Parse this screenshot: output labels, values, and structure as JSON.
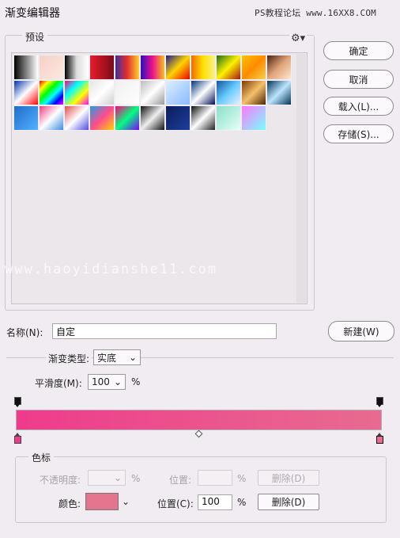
{
  "window": {
    "title": "渐变编辑器",
    "watermark_top": "PS教程论坛 www.16XX8.COM",
    "watermark_mid": "www.haoyidianshe11.com"
  },
  "buttons": {
    "ok": "确定",
    "cancel": "取消",
    "load": "载入(L)...",
    "save": "存储(S)...",
    "new": "新建(W)"
  },
  "presets": {
    "label": "预设",
    "gear": "⚙▾",
    "swatches": [
      "linear-gradient(90deg,#000,#fff)",
      "linear-gradient(135deg,#f6d0c6,#fbe9e0)",
      "linear-gradient(90deg,#000,#ddd,#fff)",
      "linear-gradient(90deg,#e81c2b,#7c0b18)",
      "linear-gradient(90deg,#3b2f9b,#e72f2f,#fcd22a)",
      "linear-gradient(90deg,#2a0fbf,#ec0f8a,#f7c21f)",
      "linear-gradient(135deg,#1a1a8f,#ffd400,#e80000)",
      "linear-gradient(90deg,#f06c00,#ffe200,#f9f08c)",
      "linear-gradient(135deg,#1d6b1a,#fff200,#a31515)",
      "linear-gradient(135deg,#f8c300,#ff8b00,#f1d34a)",
      "linear-gradient(135deg,#4b1f10,#e1a47a,#ffe9d2)",
      "linear-gradient(135deg,#0033aa,#ffffff,#ff0000)",
      "linear-gradient(135deg,#ff0000,#ffff00,#00ff00,#00ffff,#0000ff,#ff00ff)",
      "linear-gradient(135deg,#ff0080,#00ffff,#ffff00,#ff00ff)",
      "linear-gradient(135deg,#e5e5e5,#ffffff,#cfcfcf)",
      "linear-gradient(135deg,#f0f0f0,#ffffff)",
      "linear-gradient(135deg,#bbbbbb,#ffffff,#999999)",
      "linear-gradient(135deg,#ddeeff,#88bbff)",
      "linear-gradient(135deg,#003377,#ffffff,#001155)",
      "linear-gradient(135deg,#115599,#66ccff,#eeeeff)",
      "linear-gradient(135deg,#7a3b00,#f5c06b,#4a2600)",
      "linear-gradient(135deg,#003355,#bfe5ff,#003355)",
      "linear-gradient(135deg,#1d6cc8,#52b2ff)",
      "linear-gradient(135deg,#ec3c84,#ffffff,#3c8ce0)",
      "linear-gradient(135deg,#e14d4d,#ffffff,#4d4de1)",
      "linear-gradient(135deg,#20a0e0,#ff4c8f,#ffd000)",
      "linear-gradient(135deg,#ff007f,#00ff7f,#7f00ff)",
      "linear-gradient(135deg,#111,#eee,#111)",
      "linear-gradient(135deg,#0b1e5a,#1d3e9e)",
      "linear-gradient(135deg,#0c0c0c,#ffffff,#222)",
      "linear-gradient(135deg,#8ae0c8,#e6fff7)",
      "linear-gradient(135deg,#ff77ff,#77ffff)"
    ]
  },
  "name": {
    "label": "名称(N):",
    "value": "自定"
  },
  "gradient_type": {
    "label": "渐变类型:",
    "value": "实底"
  },
  "smoothness": {
    "label": "平滑度(M):",
    "value": "100",
    "unit": "%"
  },
  "gradient": {
    "start_color": "#ee3b8b",
    "end_color": "#e86b90"
  },
  "color_stops": {
    "label": "色标",
    "opacity_label": "不透明度:",
    "opacity_unit": "%",
    "location_label_disabled": "位置:",
    "location_unit_disabled": "%",
    "delete_disabled": "删除(D)",
    "color_label": "颜色:",
    "color_value": "#e5748e",
    "location_label": "位置(C):",
    "location_value": "100",
    "location_unit": "%",
    "delete": "删除(D)"
  }
}
